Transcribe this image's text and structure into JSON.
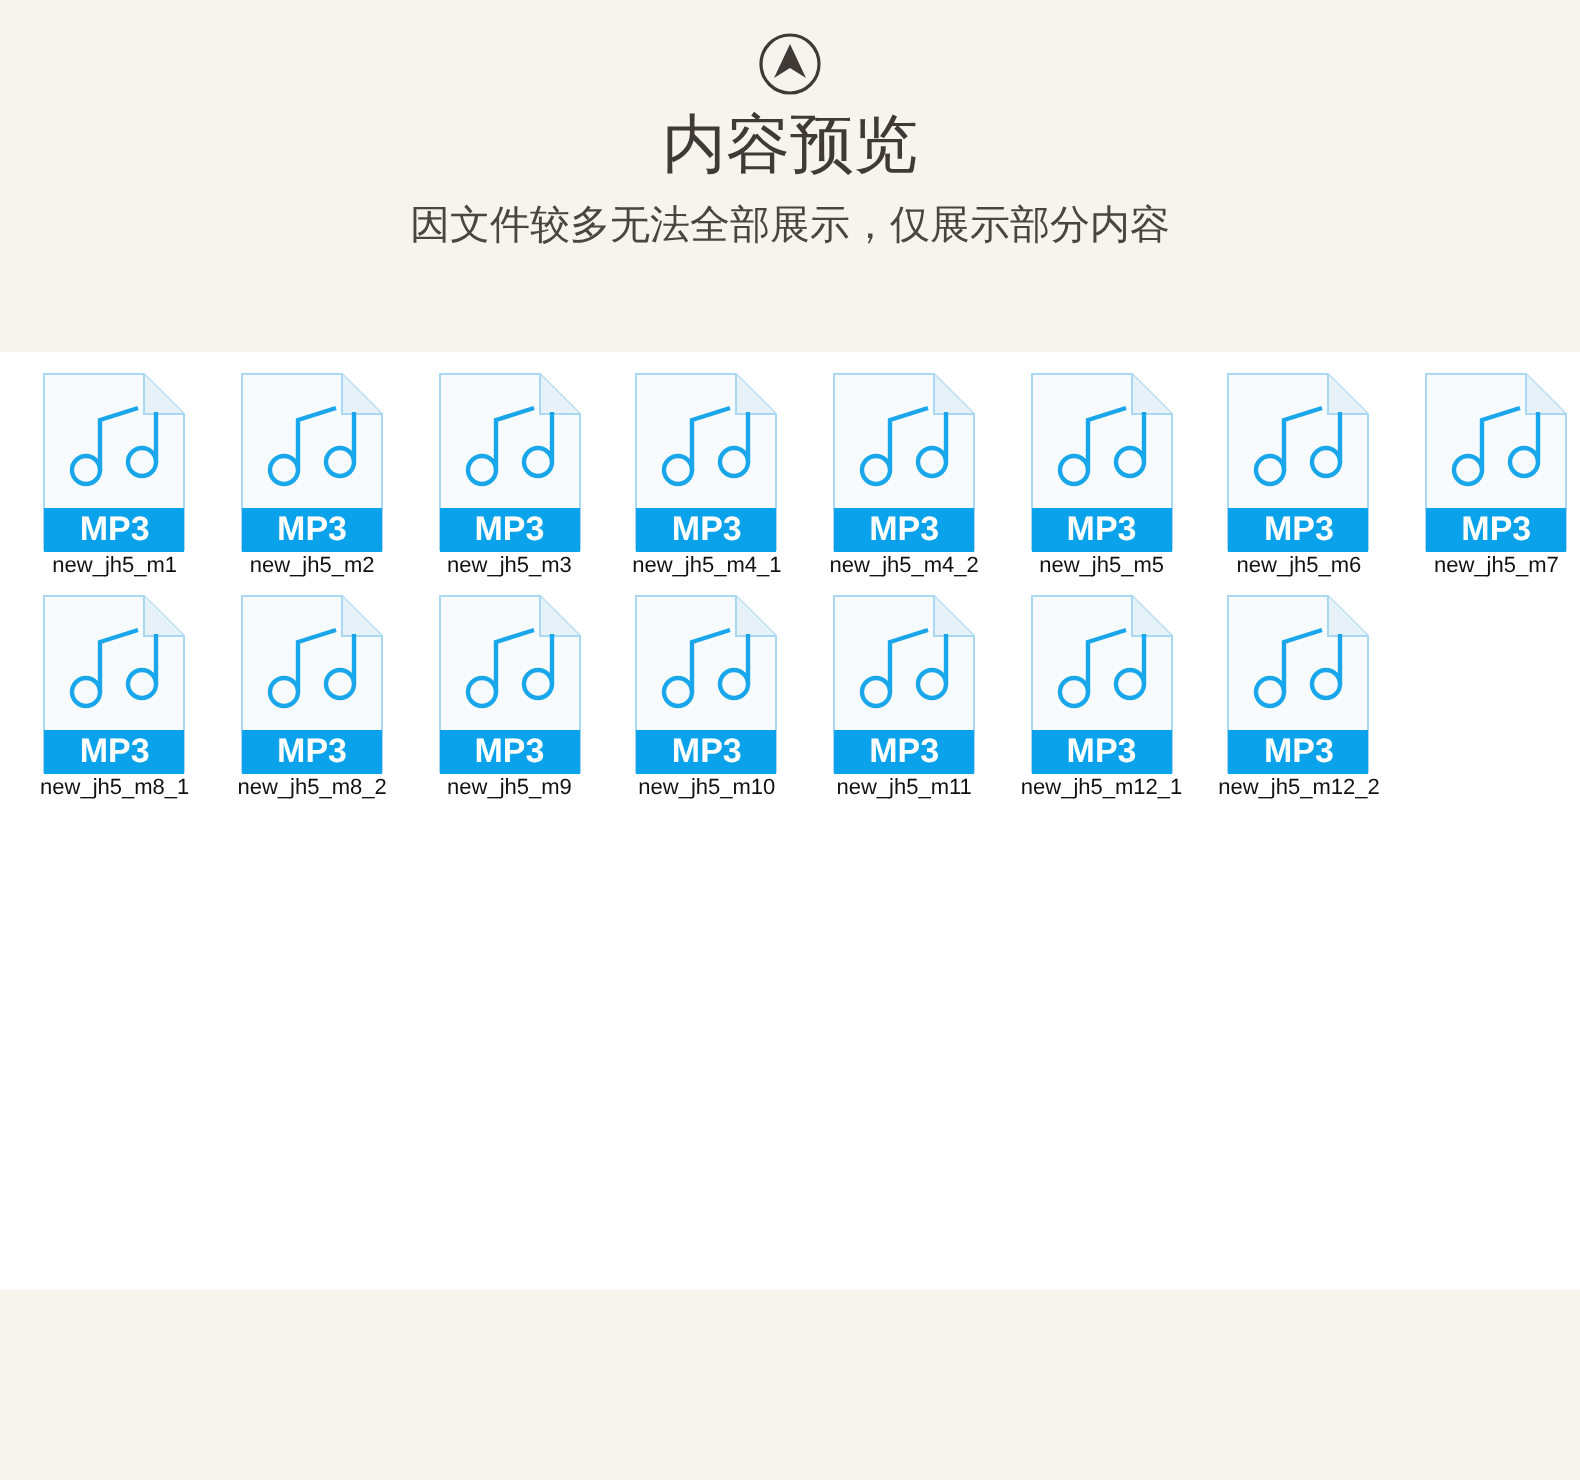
{
  "header": {
    "title": "内容预览",
    "subtitle": "因文件较多无法全部展示，仅展示部分内容"
  },
  "files": [
    {
      "type": "MP3",
      "name": "new_jh5_m1"
    },
    {
      "type": "MP3",
      "name": "new_jh5_m2"
    },
    {
      "type": "MP3",
      "name": "new_jh5_m3"
    },
    {
      "type": "MP3",
      "name": "new_jh5_m4_1"
    },
    {
      "type": "MP3",
      "name": "new_jh5_m4_2"
    },
    {
      "type": "MP3",
      "name": "new_jh5_m5"
    },
    {
      "type": "MP3",
      "name": "new_jh5_m6"
    },
    {
      "type": "MP3",
      "name": "new_jh5_m7"
    },
    {
      "type": "MP3",
      "name": "new_jh5_m8_1"
    },
    {
      "type": "MP3",
      "name": "new_jh5_m8_2"
    },
    {
      "type": "MP3",
      "name": "new_jh5_m9"
    },
    {
      "type": "MP3",
      "name": "new_jh5_m10"
    },
    {
      "type": "MP3",
      "name": "new_jh5_m11"
    },
    {
      "type": "MP3",
      "name": "new_jh5_m12_1"
    },
    {
      "type": "MP3",
      "name": "new_jh5_m12_2"
    }
  ]
}
